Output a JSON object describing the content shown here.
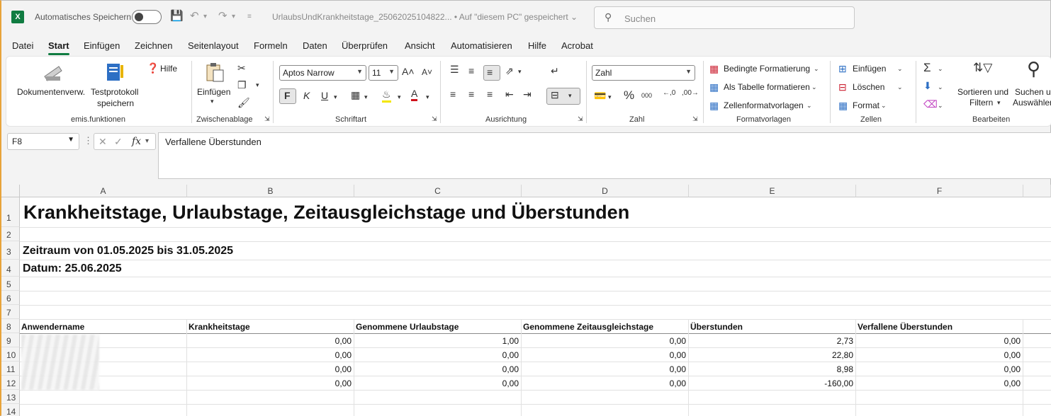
{
  "titlebar": {
    "app_logo": "X",
    "autosave_label": "Automatisches Speichern",
    "doc_title": "UrlaubsUndKrankheitstage_25062025104822... • Auf \"diesem PC\" gespeichert ⌄",
    "search_placeholder": "Suchen"
  },
  "menu": {
    "tabs": [
      "Datei",
      "Start",
      "Einfügen",
      "Zeichnen",
      "Seitenlayout",
      "Formeln",
      "Daten",
      "Überprüfen",
      "Ansicht",
      "Automatisieren",
      "Hilfe",
      "Acrobat"
    ],
    "active": "Start"
  },
  "ribbon": {
    "emis": {
      "doc_btn": "Dokumentenverw.",
      "test_btn_1": "Testprotokoll",
      "test_btn_2": "speichern",
      "help_btn": "Hilfe",
      "label": "emis.funktionen"
    },
    "clipboard": {
      "paste": "Einfügen",
      "label": "Zwischenablage"
    },
    "font": {
      "name": "Aptos Narrow",
      "size": "11",
      "bold": "F",
      "italic": "K",
      "underline": "U",
      "label": "Schriftart"
    },
    "align": {
      "label": "Ausrichtung"
    },
    "number": {
      "format": "Zahl",
      "label": "Zahl"
    },
    "styles": {
      "cond": "Bedingte Formatierung",
      "table": "Als Tabelle formatieren",
      "cellstyles": "Zellenformatvorlagen",
      "label": "Formatvorlagen"
    },
    "cells": {
      "insert": "Einfügen",
      "delete": "Löschen",
      "format": "Format",
      "label": "Zellen"
    },
    "edit": {
      "sort_1": "Sortieren und",
      "sort_2": "Filtern",
      "find_1": "Suchen und",
      "find_2": "Auswählen",
      "label": "Bearbeiten"
    }
  },
  "formula_bar": {
    "name_box": "F8",
    "content": "Verfallene Überstunden"
  },
  "sheet": {
    "columns": [
      "A",
      "B",
      "C",
      "D",
      "E",
      "F"
    ],
    "rows": [
      "1",
      "2",
      "3",
      "4",
      "5",
      "6",
      "7",
      "8",
      "9",
      "10",
      "11",
      "12",
      "13",
      "14"
    ],
    "title": "Krankheitstage, Urlaubstage, Zeitausgleichstage und Überstunden",
    "period": "Zeitraum von 01.05.2025 bis 31.05.2025",
    "date": "Datum: 25.06.2025",
    "headers": [
      "Anwendername",
      "Krankheitstage",
      "Genommene Urlaubstage",
      "Genommene Zeitausgleichstage",
      "Überstunden",
      "Verfallene Überstunden"
    ],
    "data": [
      [
        "0,00",
        "1,00",
        "0,00",
        "2,73",
        "0,00"
      ],
      [
        "0,00",
        "0,00",
        "0,00",
        "22,80",
        "0,00"
      ],
      [
        "0,00",
        "0,00",
        "0,00",
        "8,98",
        "0,00"
      ],
      [
        "0,00",
        "0,00",
        "0,00",
        "-160,00",
        "0,00"
      ]
    ]
  }
}
